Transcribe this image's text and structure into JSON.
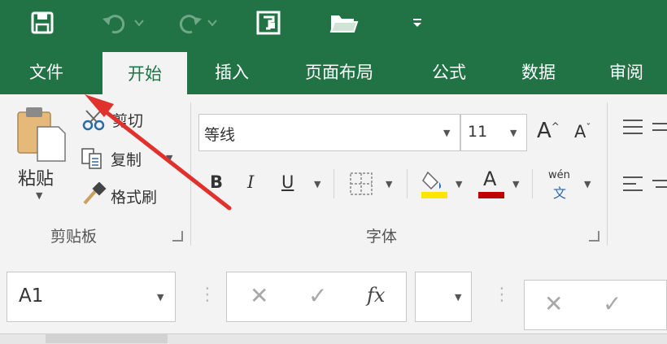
{
  "tabs": [
    "文件",
    "开始",
    "插入",
    "页面布局",
    "公式",
    "数据",
    "审阅"
  ],
  "clipboard": {
    "paste_label": "粘贴",
    "cut_label": "剪切",
    "copy_label": "复制",
    "format_painter_label": "格式刷",
    "group_label": "剪贴板"
  },
  "font": {
    "font_name": "等线",
    "font_size": "11",
    "group_label": "字体",
    "bold": "B",
    "italic": "I",
    "underline": "U",
    "grow_font": "A",
    "shrink_font": "A",
    "font_color_letter": "A",
    "phonetic_top": "wén",
    "phonetic_bottom": "文"
  },
  "formula_bar": {
    "name_box": "A1",
    "fx_label": "fx",
    "cancel_symbol": "✕",
    "enter_symbol": "✓"
  },
  "colors": {
    "accent_green": "#217346",
    "highlight_yellow": "#ffe600",
    "font_red": "#c00000",
    "arrow_red": "#e0312d"
  }
}
